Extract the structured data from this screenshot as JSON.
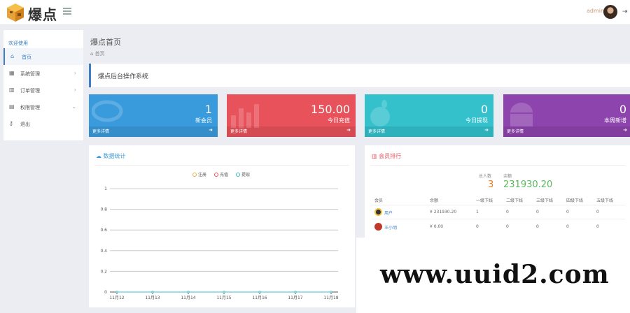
{
  "app": {
    "logo_text": "爆点",
    "user": "admin"
  },
  "page": {
    "title": "爆点首页",
    "breadcrumb": "首页",
    "welcome": "爆点后台操作系统"
  },
  "sidebar": {
    "title": "欢迎使用",
    "items": [
      {
        "label": "首页",
        "icon": "home-icon",
        "active": true
      },
      {
        "label": "系统管理",
        "icon": "table-icon"
      },
      {
        "label": "订单管理",
        "icon": "bar-chart-icon"
      },
      {
        "label": "权限管理",
        "icon": "settings-icon"
      },
      {
        "label": "退出",
        "icon": "key-icon"
      }
    ]
  },
  "stats": [
    {
      "value": "1",
      "label": "新会员",
      "more": "更多详情",
      "color": "#3a9bdc"
    },
    {
      "value": "150.00",
      "label": "今日充值",
      "more": "更多详情",
      "color": "#e8525b"
    },
    {
      "value": "0",
      "label": "今日提现",
      "more": "更多详情",
      "color": "#34c1cc"
    },
    {
      "value": "0",
      "label": "本周新增",
      "more": "更多详情",
      "color": "#8e44ad"
    }
  ],
  "chart_panel": {
    "title": "数据统计"
  },
  "chart_data": {
    "type": "line",
    "categories": [
      "11月12",
      "11月13",
      "11月14",
      "11月15",
      "11月16",
      "11月17",
      "11月18"
    ],
    "series": [
      {
        "name": "注册",
        "values": [
          0,
          0,
          0,
          0,
          0,
          0,
          0
        ],
        "color": "#e8b64a"
      },
      {
        "name": "充值",
        "values": [
          0,
          0,
          0,
          0,
          0,
          0,
          0
        ],
        "color": "#e8525b"
      },
      {
        "name": "提现",
        "values": [
          0,
          0,
          0,
          0,
          0,
          0,
          0
        ],
        "color": "#34c1cc"
      }
    ],
    "yticks": [
      "0",
      "0.2",
      "0.4",
      "0.6",
      "0.8",
      "1"
    ],
    "ylim": [
      0,
      1
    ],
    "grid": true,
    "legend": "top-center"
  },
  "members_panel": {
    "title": "会员排行",
    "summary": [
      {
        "label": "总人数",
        "value": "3",
        "color": "#e67e22"
      },
      {
        "label": "余额",
        "value": "231930.20",
        "color": "#5cb85c"
      }
    ],
    "columns": [
      "会员",
      "余额",
      "一级下线",
      "二级下线",
      "三级下线",
      "四级下线",
      "五级下线"
    ],
    "rows": [
      {
        "name": "用户",
        "balance": "¥ 231930.20",
        "l1": "1",
        "l2": "0",
        "l3": "0",
        "l4": "0",
        "l5": "0"
      },
      {
        "name": "王小明",
        "balance": "¥ 0.00",
        "l1": "0",
        "l2": "0",
        "l3": "0",
        "l4": "0",
        "l5": "0"
      }
    ]
  },
  "watermark": "www.uuid2.com"
}
